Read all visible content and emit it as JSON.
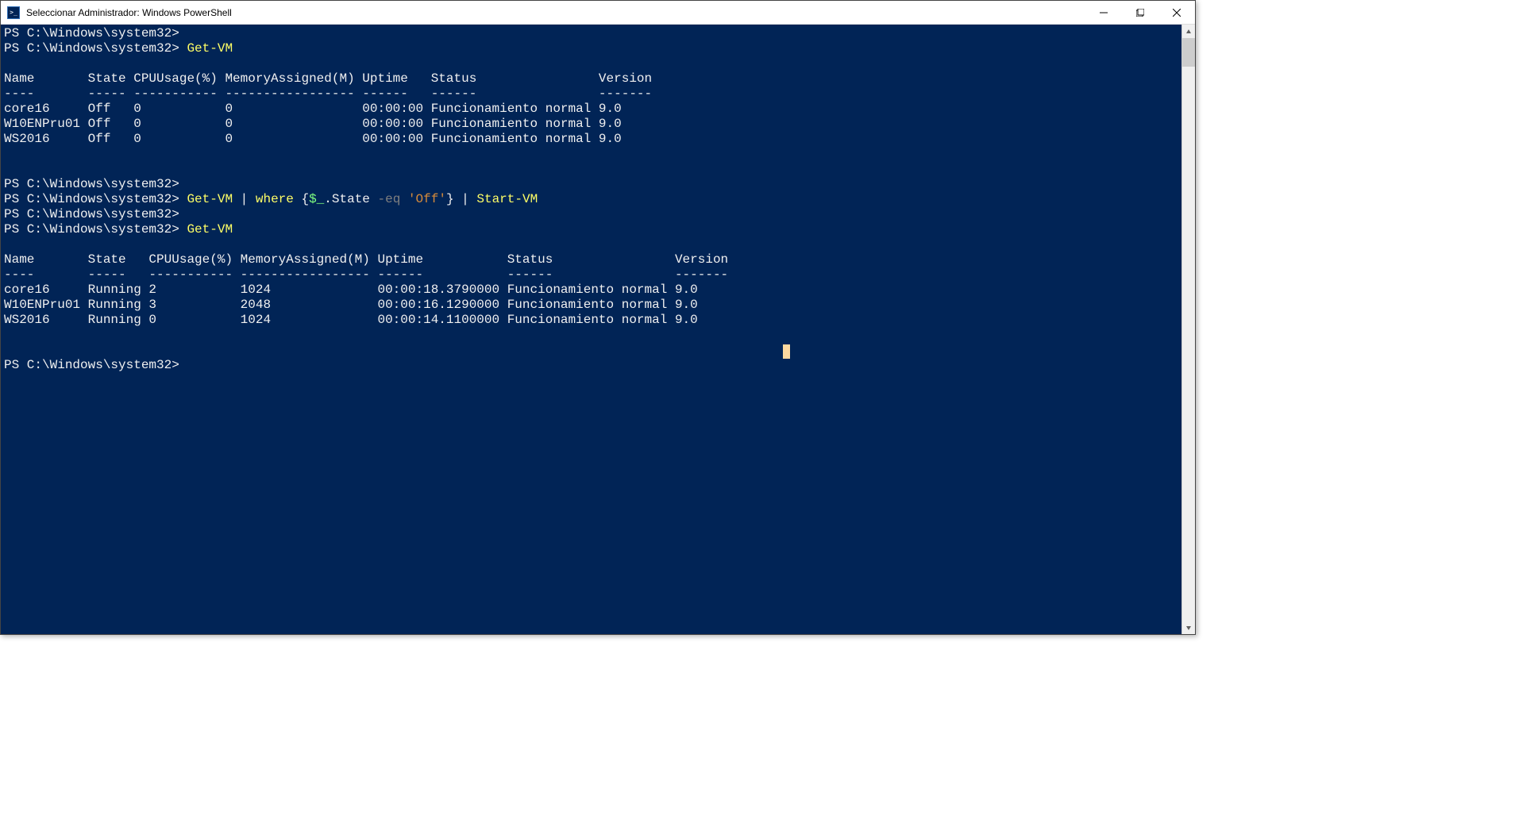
{
  "window": {
    "title": "Seleccionar Administrador: Windows PowerShell"
  },
  "prompt": "PS C:\\Windows\\system32>",
  "cmd": {
    "getvm": "Get-VM",
    "pipe": " | ",
    "where": "where",
    "brace_open": " {",
    "dollar_under": "$_",
    "dot_state": ".State ",
    "eq": "-eq",
    "space": " ",
    "off_str": "'Off'",
    "brace_close": "}",
    "startvm": "Start-VM"
  },
  "table1": {
    "headers": [
      "Name",
      "State",
      "CPUUsage(%)",
      "MemoryAssigned(M)",
      "Uptime",
      "Status",
      "Version"
    ],
    "dashes": [
      "----",
      "-----",
      "-----------",
      "-----------------",
      "------",
      "------",
      "-------"
    ],
    "rows": [
      {
        "Name": "core16",
        "State": "Off",
        "CPU": "0",
        "Mem": "0",
        "Uptime": "00:00:00",
        "Status": "Funcionamiento normal",
        "Version": "9.0"
      },
      {
        "Name": "W10ENPru01",
        "State": "Off",
        "CPU": "0",
        "Mem": "0",
        "Uptime": "00:00:00",
        "Status": "Funcionamiento normal",
        "Version": "9.0"
      },
      {
        "Name": "WS2016",
        "State": "Off",
        "CPU": "0",
        "Mem": "0",
        "Uptime": "00:00:00",
        "Status": "Funcionamiento normal",
        "Version": "9.0"
      }
    ],
    "widths": {
      "Name": 10,
      "State": 5,
      "CPU": 11,
      "Mem": 17,
      "Uptime": 8,
      "Status": 21,
      "Version": 7
    }
  },
  "table2": {
    "headers": [
      "Name",
      "State",
      "CPUUsage(%)",
      "MemoryAssigned(M)",
      "Uptime",
      "Status",
      "Version"
    ],
    "dashes": [
      "----",
      "-----",
      "-----------",
      "-----------------",
      "------",
      "------",
      "-------"
    ],
    "rows": [
      {
        "Name": "core16",
        "State": "Running",
        "CPU": "2",
        "Mem": "1024",
        "Uptime": "00:00:18.3790000",
        "Status": "Funcionamiento normal",
        "Version": "9.0"
      },
      {
        "Name": "W10ENPru01",
        "State": "Running",
        "CPU": "3",
        "Mem": "2048",
        "Uptime": "00:00:16.1290000",
        "Status": "Funcionamiento normal",
        "Version": "9.0"
      },
      {
        "Name": "WS2016",
        "State": "Running",
        "CPU": "0",
        "Mem": "1024",
        "Uptime": "00:00:14.1100000",
        "Status": "Funcionamiento normal",
        "Version": "9.0"
      }
    ],
    "widths": {
      "Name": 10,
      "State": 7,
      "CPU": 11,
      "Mem": 17,
      "Uptime": 16,
      "Status": 21,
      "Version": 7
    }
  }
}
